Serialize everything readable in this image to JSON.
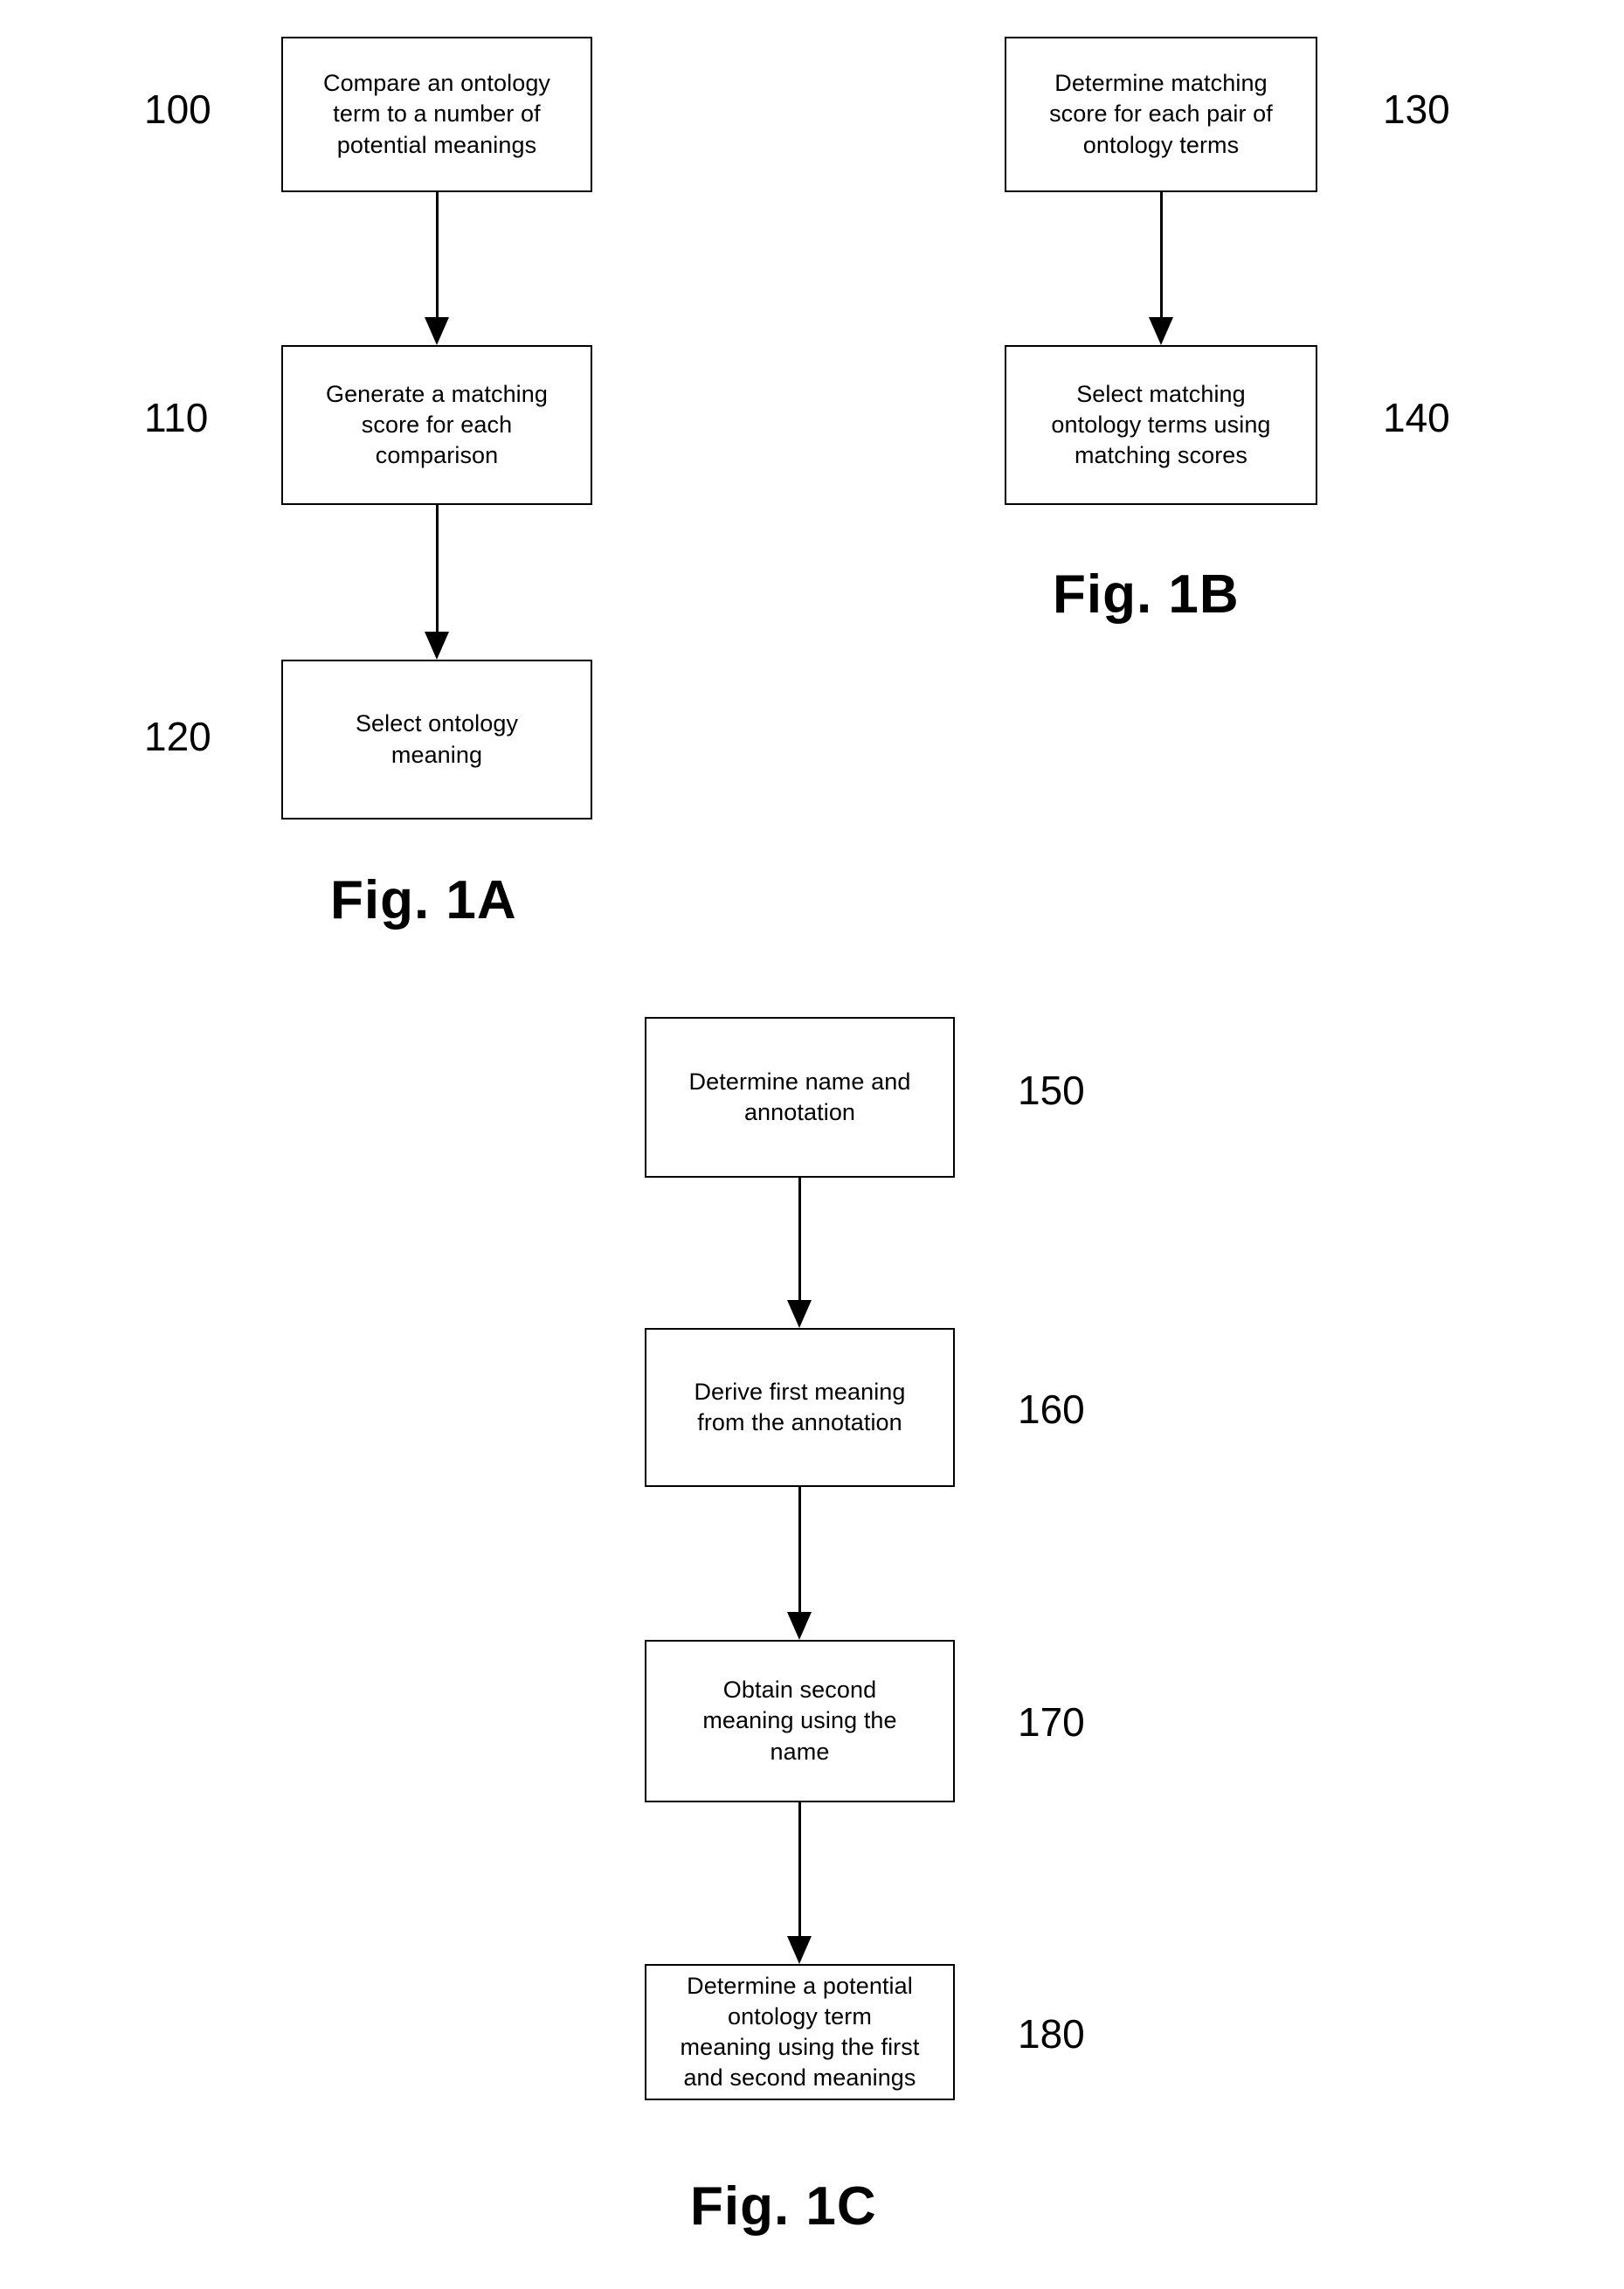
{
  "figures": [
    {
      "id": "fig-1a",
      "caption": "Fig. 1A",
      "steps": [
        {
          "ref": "100",
          "text": "Compare an ontology\nterm to a number of\npotential meanings"
        },
        {
          "ref": "110",
          "text": "Generate a matching\nscore for each\ncomparison"
        },
        {
          "ref": "120",
          "text": "Select ontology\nmeaning"
        }
      ]
    },
    {
      "id": "fig-1b",
      "caption": "Fig. 1B",
      "steps": [
        {
          "ref": "130",
          "text": "Determine matching\nscore for each pair of\nontology terms"
        },
        {
          "ref": "140",
          "text": "Select matching\nontology terms using\nmatching scores"
        }
      ]
    },
    {
      "id": "fig-1c",
      "caption": "Fig. 1C",
      "steps": [
        {
          "ref": "150",
          "text": "Determine name and\nannotation"
        },
        {
          "ref": "160",
          "text": "Derive first meaning\nfrom the annotation"
        },
        {
          "ref": "170",
          "text": "Obtain second\nmeaning using the\nname"
        },
        {
          "ref": "180",
          "text": "Determine a potential\nontology term\nmeaning using the first\nand second meanings"
        }
      ]
    }
  ],
  "colors": {
    "ink": "#000000",
    "paper": "#ffffff"
  }
}
